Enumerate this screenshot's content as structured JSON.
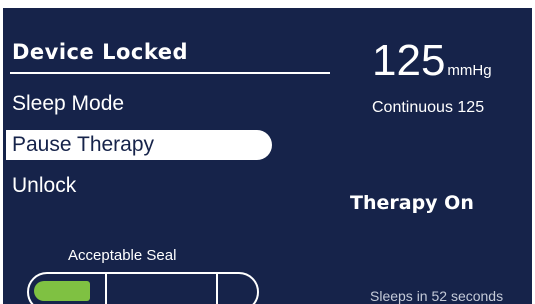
{
  "menu": {
    "title": "Device Locked",
    "items": [
      {
        "label": "Sleep Mode",
        "selected": false
      },
      {
        "label": "Pause Therapy",
        "selected": true
      },
      {
        "label": "Unlock",
        "selected": false
      }
    ]
  },
  "pressure": {
    "value": "125",
    "unit": "mmHg",
    "mode": "Continuous 125"
  },
  "status": {
    "therapy": "Therapy On"
  },
  "seal": {
    "label": "Acceptable Seal",
    "segments_total": 3,
    "segments_filled": 1,
    "fill_color": "#7fc142"
  },
  "footer": {
    "sleep_timer": "Sleeps in 52 seconds"
  },
  "colors": {
    "background": "#16234a",
    "foreground": "#ffffff",
    "selected_text": "#16234a"
  }
}
